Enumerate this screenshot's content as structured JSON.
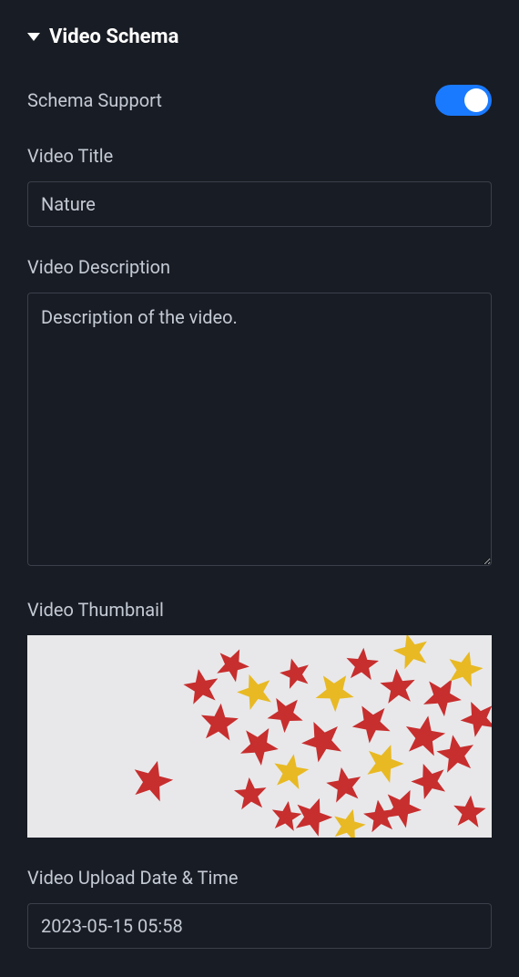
{
  "section": {
    "title": "Video Schema"
  },
  "schema_support": {
    "label": "Schema Support",
    "enabled": true
  },
  "video_title": {
    "label": "Video Title",
    "value": "Nature"
  },
  "video_description": {
    "label": "Video Description",
    "value": "Description of the video."
  },
  "video_thumbnail": {
    "label": "Video Thumbnail"
  },
  "upload_date": {
    "label": "Video Upload Date & Time",
    "value": "2023-05-15 05:58"
  },
  "colors": {
    "accent": "#1a7aff",
    "star_red": "#c72e2e",
    "star_gold": "#e8b923"
  }
}
